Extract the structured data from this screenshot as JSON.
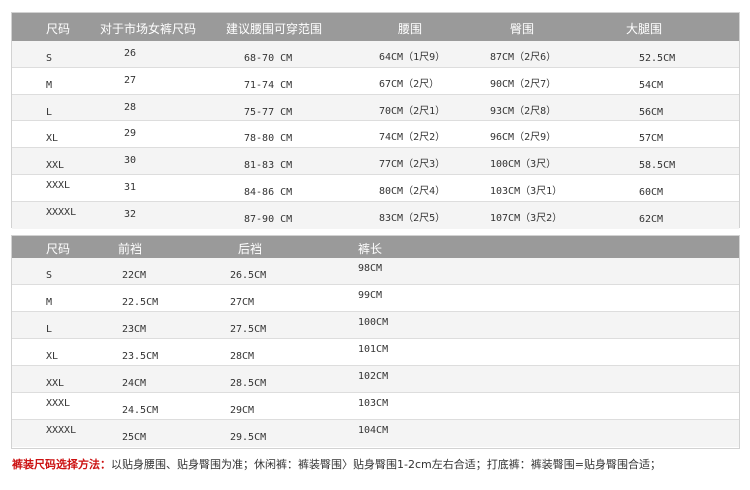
{
  "table1": {
    "headers": [
      "尺码",
      "对于市场女裤尺码",
      "建议腰围可穿范围",
      "腰围",
      "臀围",
      "大腿围"
    ],
    "rows": [
      [
        "S",
        "26",
        "68-70 CM",
        "64CM（1尺9）",
        "87CM（2尺6）",
        "52.5CM"
      ],
      [
        "M",
        "27",
        "71-74 CM",
        "67CM（2尺）",
        "90CM（2尺7）",
        "54CM"
      ],
      [
        "L",
        "28",
        "75-77 CM",
        "70CM（2尺1）",
        "93CM（2尺8）",
        "56CM"
      ],
      [
        "XL",
        "29",
        "78-80 CM",
        "74CM（2尺2）",
        "96CM（2尺9）",
        "57CM"
      ],
      [
        "XXL",
        "30",
        "81-83 CM",
        "77CM（2尺3）",
        "100CM（3尺）",
        "58.5CM"
      ],
      [
        "XXXL",
        "31",
        "84-86 CM",
        "80CM（2尺4）",
        "103CM（3尺1）",
        "60CM"
      ],
      [
        "XXXXL",
        "32",
        "87-90 CM",
        "83CM（2尺5）",
        "107CM（3尺2）",
        "62CM"
      ]
    ]
  },
  "table2": {
    "headers": [
      "尺码",
      "前裆",
      "后裆",
      "裤长"
    ],
    "rows": [
      [
        "S",
        "22CM",
        "26.5CM",
        "98CM"
      ],
      [
        "M",
        "22.5CM",
        "27CM",
        "99CM"
      ],
      [
        "L",
        "23CM",
        "27.5CM",
        "100CM"
      ],
      [
        "XL",
        "23.5CM",
        "28CM",
        "101CM"
      ],
      [
        "XXL",
        "24CM",
        "28.5CM",
        "102CM"
      ],
      [
        "XXXL",
        "24.5CM",
        "29CM",
        "103CM"
      ],
      [
        "XXXXL",
        "25CM",
        "29.5CM",
        "104CM"
      ]
    ]
  },
  "note": {
    "label": "裤装尺码选择方法：",
    "text": "以贴身腰围、贴身臀围为准；休闲裤：裤装臀围〉贴身臀围1-2cm左右合适；打底裤：裤装臀围=贴身臀围合适；"
  }
}
